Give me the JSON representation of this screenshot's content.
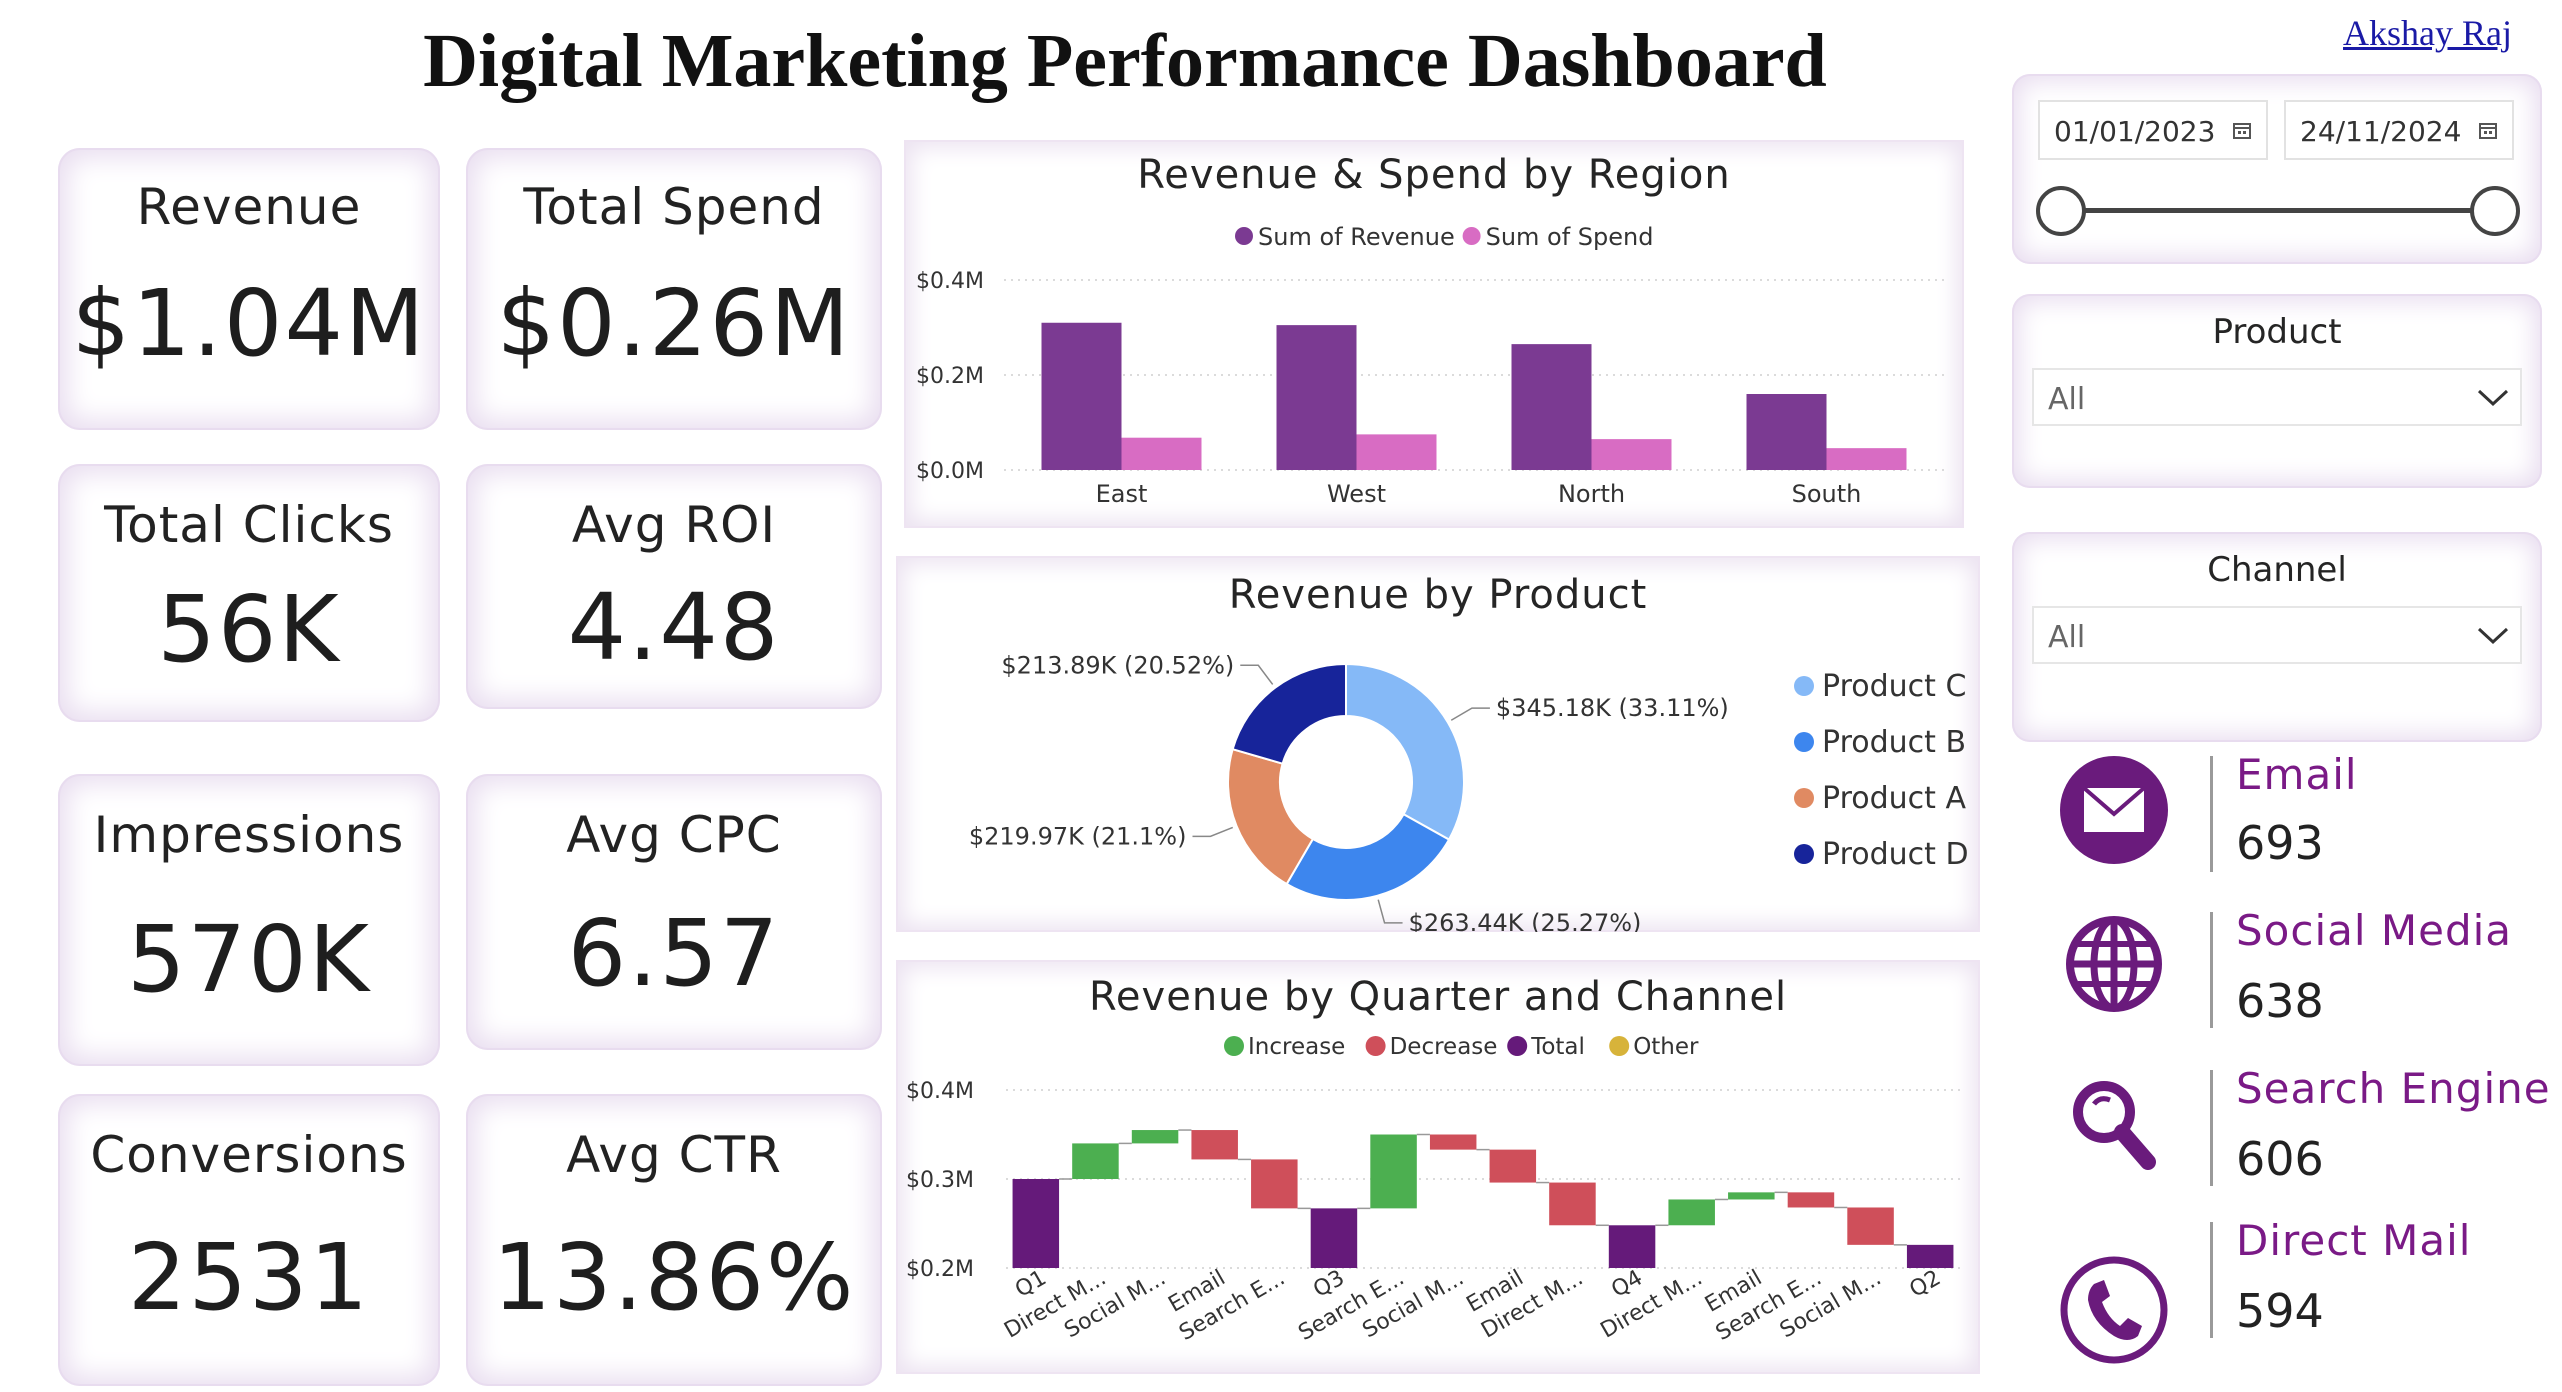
{
  "header": {
    "title": "Digital Marketing Performance Dashboard",
    "author_link": "Akshay Raj"
  },
  "kpis": [
    {
      "label": "Revenue",
      "value": "$1.04M"
    },
    {
      "label": "Total Spend",
      "value": "$0.26M"
    },
    {
      "label": "Total Clicks",
      "value": "56K"
    },
    {
      "label": "Avg ROI",
      "value": "4.48"
    },
    {
      "label": "Impressions",
      "value": "570K"
    },
    {
      "label": "Avg CPC",
      "value": "6.57"
    },
    {
      "label": "Conversions",
      "value": "2531"
    },
    {
      "label": "Avg CTR",
      "value": "13.86%"
    }
  ],
  "filters": {
    "date_start": "01/01/2023",
    "date_end": "24/11/2024",
    "product": {
      "title": "Product",
      "selected": "All"
    },
    "channel": {
      "title": "Channel",
      "selected": "All"
    }
  },
  "channels": [
    {
      "name": "Email",
      "count": "693",
      "icon": "envelope-icon"
    },
    {
      "name": "Social Media",
      "count": "638",
      "icon": "globe-icon"
    },
    {
      "name": "Search Engine",
      "count": "606",
      "icon": "search-icon"
    },
    {
      "name": "Direct Mail",
      "count": "594",
      "icon": "phone-icon"
    }
  ],
  "colors": {
    "accent": "#6a1b7c",
    "revenue": "#7b3a92",
    "spend": "#d86cc3",
    "increase": "#4caf50",
    "decrease": "#cf4f5a",
    "total": "#651a7a",
    "other": "#d7b33a"
  },
  "chart_data": [
    {
      "type": "bar",
      "title": "Revenue & Spend by Region",
      "categories": [
        "East",
        "West",
        "North",
        "South"
      ],
      "series": [
        {
          "name": "Sum of Revenue",
          "values": [
            0.31,
            0.305,
            0.265,
            0.16
          ]
        },
        {
          "name": "Sum of Spend",
          "values": [
            0.068,
            0.075,
            0.065,
            0.046
          ]
        }
      ],
      "ytick_labels": [
        "$0.0M",
        "$0.2M",
        "$0.4M"
      ],
      "ylim": [
        0,
        0.4
      ],
      "legend": "top-center",
      "grid": true
    },
    {
      "type": "pie",
      "title": "Revenue by Product",
      "donut": true,
      "slices": [
        {
          "name": "Product C",
          "value": 345.18,
          "label": "$345.18K (33.11%)",
          "color": "#85b9f7"
        },
        {
          "name": "Product B",
          "value": 263.44,
          "label": "$263.44K (25.27%)",
          "color": "#3d86ee"
        },
        {
          "name": "Product A",
          "value": 219.97,
          "label": "$219.97K (21.1%)",
          "color": "#e08a62"
        },
        {
          "name": "Product D",
          "value": 213.89,
          "label": "$213.89K (20.52%)",
          "color": "#17249a"
        }
      ],
      "legend": "right"
    },
    {
      "type": "waterfall",
      "title": "Revenue by Quarter and Channel",
      "legend_items": [
        "Increase",
        "Decrease",
        "Total",
        "Other"
      ],
      "ytick_labels": [
        "$0.2M",
        "$0.3M",
        "$0.4M"
      ],
      "ylim": [
        0.2,
        0.4
      ],
      "steps": [
        {
          "label": "Q1",
          "kind": "total",
          "start": 0.2,
          "end": 0.3
        },
        {
          "label": "Direct M...",
          "kind": "increase",
          "start": 0.3,
          "end": 0.34
        },
        {
          "label": "Social M...",
          "kind": "increase",
          "start": 0.34,
          "end": 0.355
        },
        {
          "label": "Email",
          "kind": "decrease",
          "start": 0.355,
          "end": 0.322
        },
        {
          "label": "Search E...",
          "kind": "decrease",
          "start": 0.322,
          "end": 0.267
        },
        {
          "label": "Q3",
          "kind": "total",
          "start": 0.2,
          "end": 0.267
        },
        {
          "label": "Search E...",
          "kind": "increase",
          "start": 0.267,
          "end": 0.35
        },
        {
          "label": "Social M...",
          "kind": "decrease",
          "start": 0.35,
          "end": 0.333
        },
        {
          "label": "Email",
          "kind": "decrease",
          "start": 0.333,
          "end": 0.296
        },
        {
          "label": "Direct M...",
          "kind": "decrease",
          "start": 0.296,
          "end": 0.248
        },
        {
          "label": "Q4",
          "kind": "total",
          "start": 0.2,
          "end": 0.248
        },
        {
          "label": "Direct M...",
          "kind": "increase",
          "start": 0.248,
          "end": 0.277
        },
        {
          "label": "Email",
          "kind": "increase",
          "start": 0.277,
          "end": 0.285
        },
        {
          "label": "Search E...",
          "kind": "decrease",
          "start": 0.285,
          "end": 0.268
        },
        {
          "label": "Social M...",
          "kind": "decrease",
          "start": 0.268,
          "end": 0.226
        },
        {
          "label": "Q2",
          "kind": "total",
          "start": 0.2,
          "end": 0.226
        }
      ],
      "grid": true
    }
  ]
}
